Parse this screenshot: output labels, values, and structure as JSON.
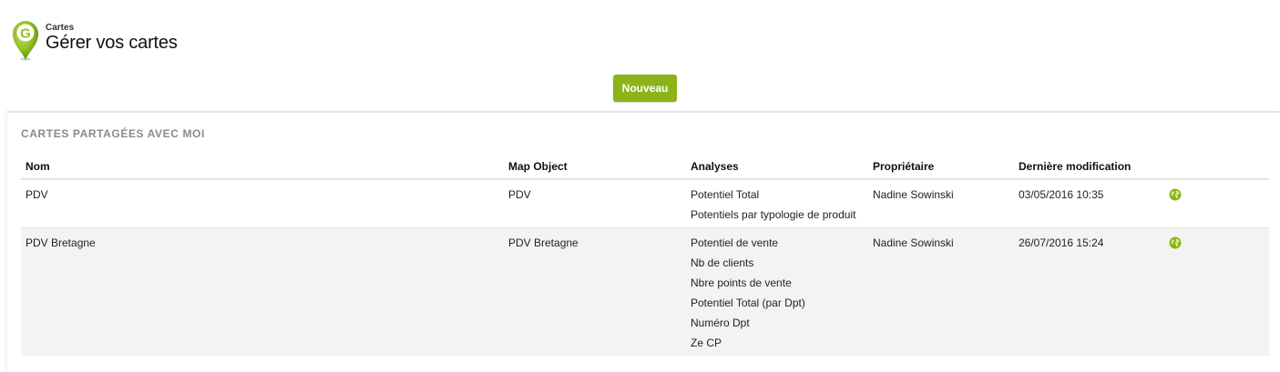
{
  "header": {
    "breadcrumb": "Cartes",
    "title": "Gérer vos cartes",
    "logo_letter": "G"
  },
  "toolbar": {
    "new_label": "Nouveau"
  },
  "section": {
    "title": "CARTES PARTAGÉES AVEC MOI"
  },
  "table": {
    "columns": [
      "Nom",
      "Map Object",
      "Analyses",
      "Propriétaire",
      "Dernière modification"
    ],
    "rows": [
      {
        "name": "PDV",
        "map_object": "PDV",
        "analyses": [
          "Potentiel Total",
          "Potentiels par typologie de produit"
        ],
        "owner": "Nadine Sowinski",
        "modified": "03/05/2016 10:35",
        "action_icon": "globe-icon"
      },
      {
        "name": "PDV Bretagne",
        "map_object": "PDV Bretagne",
        "analyses": [
          "Potentiel de vente",
          "Nb de clients",
          "Nbre points de vente",
          "Potentiel Total (par Dpt)",
          "Numéro Dpt",
          "Ze CP"
        ],
        "owner": "Nadine Sowinski",
        "modified": "26/07/2016 15:24",
        "action_icon": "globe-icon"
      }
    ]
  },
  "colors": {
    "accent": "#8bb418",
    "row_alt": "#f3f3f3",
    "section_title": "#8a8a8a"
  }
}
